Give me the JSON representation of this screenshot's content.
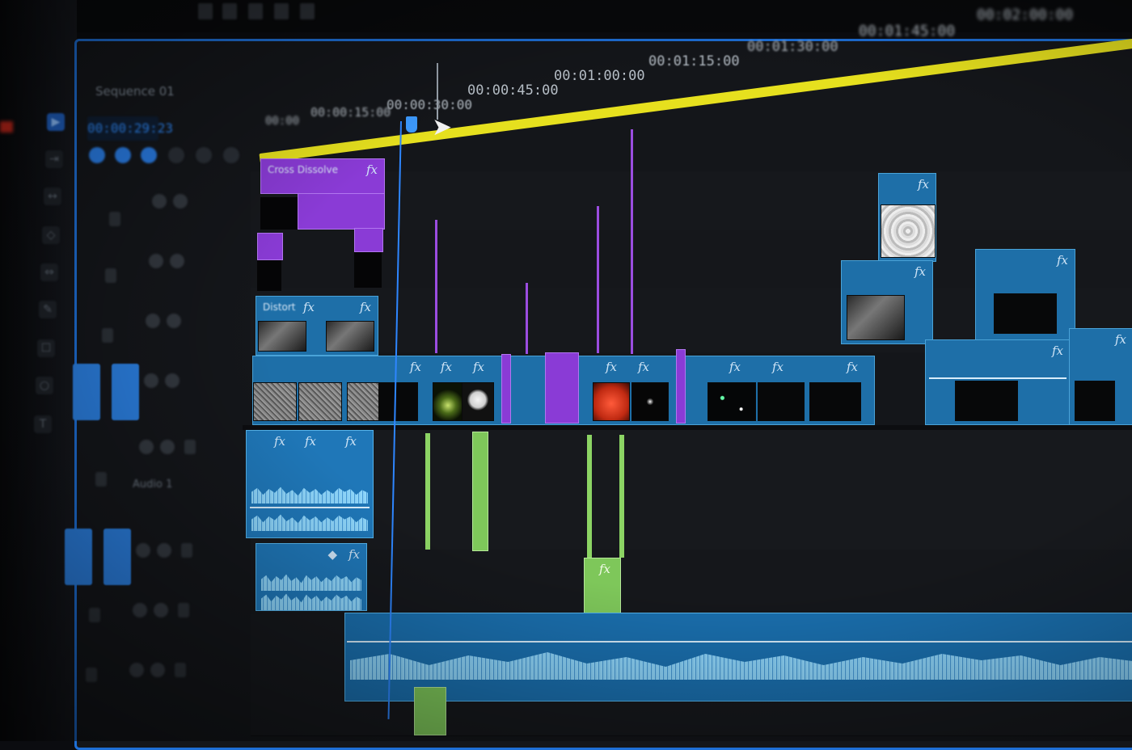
{
  "app": {
    "panel_title": "Sequence 01",
    "timecode": "00:00:29:23"
  },
  "ruler": {
    "labels": [
      {
        "text": "00:00"
      },
      {
        "text": "00:00:15:00"
      },
      {
        "text": "00:00:30:00"
      },
      {
        "text": "00:00:45:00"
      },
      {
        "text": "00:01:00:00"
      },
      {
        "text": "00:01:15:00"
      },
      {
        "text": "00:01:30:00"
      },
      {
        "text": "00:01:45:00"
      },
      {
        "text": "00:02:00:00"
      }
    ]
  },
  "tracks": {
    "v2_clip_label": "Cross Dissolve",
    "v1_clip_label": "Distort",
    "a_track_name": "Audio 1"
  },
  "icons": {
    "fx": "fx",
    "cursor": "➤",
    "transition_arrows": "◆"
  },
  "colors": {
    "accent": "#2e86ff",
    "work_area": "#e6e01e",
    "video_clip": "#1e6fa8",
    "adjustment_clip": "#8a3bd6",
    "nested_audio_clip": "#7ec75a",
    "audio_clip": "#1f77b8"
  }
}
